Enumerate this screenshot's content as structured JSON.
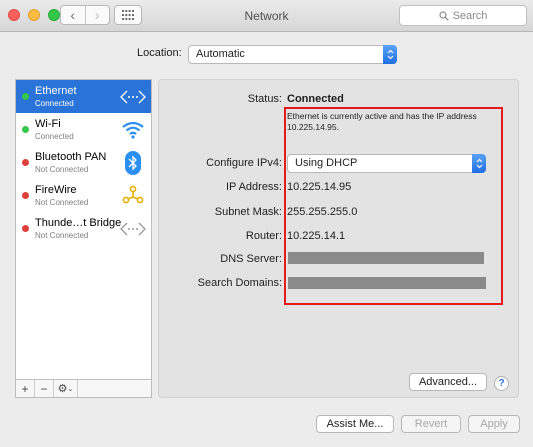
{
  "window": {
    "title": "Network"
  },
  "toolbar": {
    "back_glyph": "‹",
    "forward_glyph": "›",
    "search_placeholder": "Search"
  },
  "location": {
    "label": "Location:",
    "value": "Automatic"
  },
  "services": [
    {
      "name": "Ethernet",
      "status": "Connected",
      "status_color": "#34c84a",
      "selected": true,
      "icon": "ethernet-icon"
    },
    {
      "name": "Wi-Fi",
      "status": "Connected",
      "status_color": "#34c84a",
      "selected": false,
      "icon": "wifi-icon"
    },
    {
      "name": "Bluetooth PAN",
      "status": "Not Connected",
      "status_color": "#e0403a",
      "selected": false,
      "icon": "bluetooth-icon"
    },
    {
      "name": "FireWire",
      "status": "Not Connected",
      "status_color": "#e0403a",
      "selected": false,
      "icon": "firewire-icon"
    },
    {
      "name": "Thunde…t Bridge",
      "status": "Not Connected",
      "status_color": "#e0403a",
      "selected": false,
      "icon": "thunderbolt-bridge-icon"
    }
  ],
  "sidebar_controls": {
    "add": "+",
    "remove": "−",
    "gear": "⚙"
  },
  "details": {
    "status_label": "Status:",
    "status_value": "Connected",
    "status_description": "Ethernet is currently active and has the IP address 10.225.14.95.",
    "configure_label": "Configure IPv4:",
    "configure_value": "Using DHCP",
    "ip_label": "IP Address:",
    "ip_value": "10.225.14.95",
    "subnet_label": "Subnet Mask:",
    "subnet_value": "255.255.255.0",
    "router_label": "Router:",
    "router_value": "10.225.14.1",
    "dns_label": "DNS Server:",
    "search_domains_label": "Search Domains:"
  },
  "buttons": {
    "advanced": "Advanced...",
    "help": "?",
    "assist": "Assist Me...",
    "revert": "Revert",
    "apply": "Apply"
  },
  "colors": {
    "accent": "#2a73d8",
    "highlight_box": "#e51b1b"
  }
}
